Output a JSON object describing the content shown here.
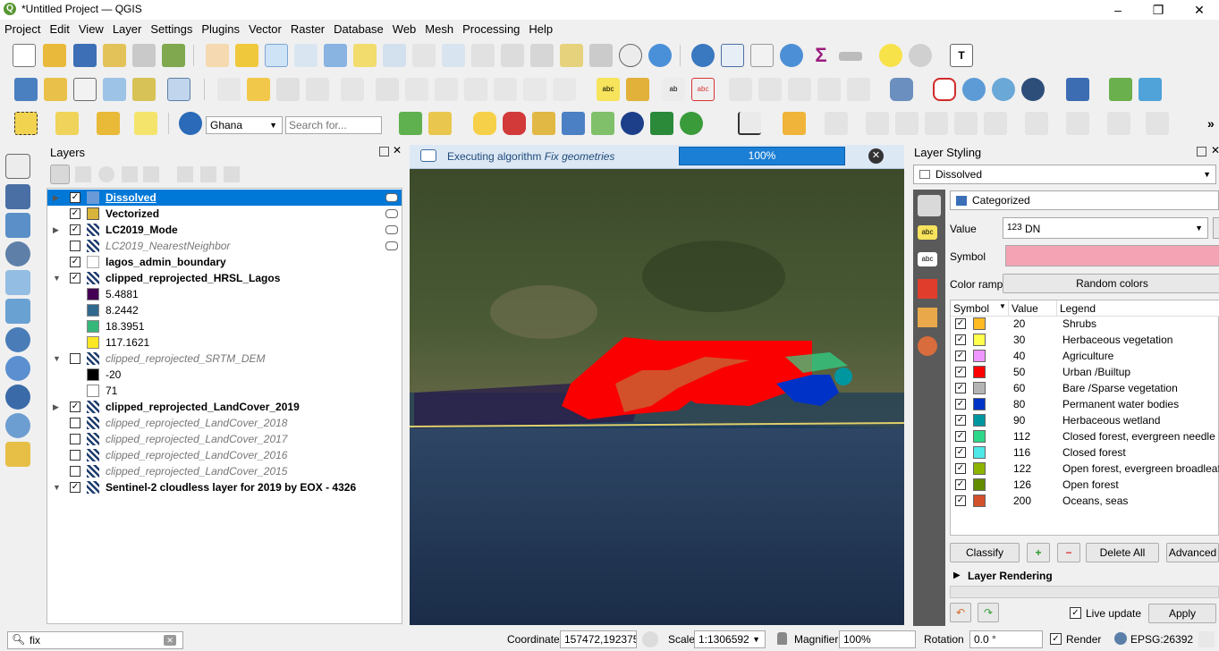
{
  "window": {
    "title": "*Untitled Project — QGIS"
  },
  "menu": [
    "Project",
    "Edit",
    "View",
    "Layer",
    "Settings",
    "Plugins",
    "Vector",
    "Raster",
    "Database",
    "Web",
    "Mesh",
    "Processing",
    "Help"
  ],
  "toolbar3": {
    "geocoder_value": "Ghana",
    "search_placeholder": "Search for..."
  },
  "layers_panel": {
    "title": "Layers",
    "rows": [
      {
        "name": "Dissolved",
        "checked": true,
        "selected": true,
        "style": "b",
        "icon": "polygon"
      },
      {
        "name": "Vectorized",
        "checked": true,
        "style": "b",
        "icon": "polygon-fill"
      },
      {
        "name": "LC2019_Mode",
        "checked": true,
        "style": "b",
        "icon": "raster"
      },
      {
        "name": "LC2019_NearestNeighbor",
        "checked": false,
        "style": "i",
        "icon": "raster"
      },
      {
        "name": "lagos_admin_boundary",
        "checked": true,
        "style": "b",
        "icon": "polygon-empty"
      },
      {
        "name": "clipped_reprojected_HRSL_Lagos",
        "checked": true,
        "style": "b",
        "icon": "raster"
      },
      {
        "name": "5.4881",
        "legend": "#440154"
      },
      {
        "name": "8.2442",
        "legend": "#31688e"
      },
      {
        "name": "18.3951",
        "legend": "#35b779"
      },
      {
        "name": "117.1621",
        "legend": "#fde725"
      },
      {
        "name": "clipped_reprojected_SRTM_DEM",
        "checked": false,
        "style": "i",
        "icon": "raster"
      },
      {
        "name": "-20",
        "legend": "#000000"
      },
      {
        "name": "71",
        "legend": "#ffffff"
      },
      {
        "name": "clipped_reprojected_LandCover_2019",
        "checked": true,
        "style": "b",
        "icon": "raster"
      },
      {
        "name": "clipped_reprojected_LandCover_2018",
        "checked": false,
        "style": "i",
        "icon": "raster"
      },
      {
        "name": "clipped_reprojected_LandCover_2017",
        "checked": false,
        "style": "i",
        "icon": "raster"
      },
      {
        "name": "clipped_reprojected_LandCover_2016",
        "checked": false,
        "style": "i",
        "icon": "raster"
      },
      {
        "name": "clipped_reprojected_LandCover_2015",
        "checked": false,
        "style": "i",
        "icon": "raster"
      },
      {
        "name": "Sentinel-2 cloudless layer for 2019 by EOX - 4326",
        "checked": true,
        "style": "b",
        "icon": "raster"
      }
    ]
  },
  "message_bar": {
    "prefix": "Executing algorithm ",
    "algorithm": "Fix geometries",
    "progress": "100%"
  },
  "style_panel": {
    "title": "Layer Styling",
    "layer": "Dissolved",
    "renderer": "Categorized",
    "value_label": "Value",
    "value_field": "DN",
    "value_prefix": "123",
    "symbol_label": "Symbol",
    "symbol_color": "#f4a3b4",
    "ramp_label": "Color ramp",
    "ramp_value": "Random colors",
    "table_headers": {
      "symbol": "Symbol",
      "value": "Value",
      "legend": "Legend"
    },
    "categories": [
      {
        "value": "20",
        "legend": "Shrubs",
        "color": "#ffbb22"
      },
      {
        "value": "30",
        "legend": "Herbaceous vegetation",
        "color": "#ffff4c"
      },
      {
        "value": "40",
        "legend": "Agriculture",
        "color": "#f096ff"
      },
      {
        "value": "50",
        "legend": "Urban /Builtup",
        "color": "#fa0000"
      },
      {
        "value": "60",
        "legend": "Bare /Sparse vegetation",
        "color": "#b4b4b4"
      },
      {
        "value": "80",
        "legend": "Permanent water bodies",
        "color": "#0032c8"
      },
      {
        "value": "90",
        "legend": "Herbaceous wetland",
        "color": "#0096a0"
      },
      {
        "value": "112",
        "legend": "Closed forest, evergreen needle leaf",
        "color": "#2ed88a"
      },
      {
        "value": "116",
        "legend": "Closed forest",
        "color": "#4ee8e8"
      },
      {
        "value": "122",
        "legend": "Open forest, evergreen broadleaf",
        "color": "#8db400"
      },
      {
        "value": "126",
        "legend": "Open forest",
        "color": "#648c00"
      },
      {
        "value": "200",
        "legend": "Oceans, seas",
        "color": "#d2502a"
      }
    ],
    "btn_classify": "Classify",
    "btn_delete_all": "Delete All",
    "btn_advanced": "Advanced",
    "layer_rendering": "Layer Rendering",
    "live_update": "Live update",
    "btn_apply": "Apply"
  },
  "status": {
    "locator_value": "fix",
    "coordinate_label": "Coordinate",
    "coordinate_value": "157472,192375",
    "scale_label": "Scale",
    "scale_value": "1:1306592",
    "magnifier_label": "Magnifier",
    "magnifier_value": "100%",
    "rotation_label": "Rotation",
    "rotation_value": "0.0 °",
    "render_label": "Render",
    "crs": "EPSG:26392"
  }
}
